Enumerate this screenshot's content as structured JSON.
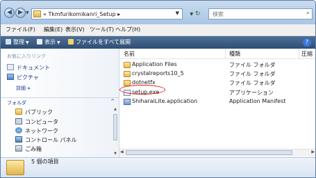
{
  "address": {
    "prefix": "«",
    "path": "Tkmfurikomikanri_Setup",
    "chevron": "▸"
  },
  "search": {
    "placeholder": "検索",
    "icon": "search-icon"
  },
  "nav": {
    "back_icon": "back-arrow-icon",
    "forward_icon": "forward-arrow-icon",
    "refresh_icon": "refresh-icon"
  },
  "menu": {
    "items": [
      "ファイル(F)",
      "編集(E)",
      "表示(V)",
      "ツール(T)",
      "ヘルプ(H)"
    ]
  },
  "toolbar": {
    "organize": "整理",
    "view": "表示",
    "burn": "ファイルをすべて展開"
  },
  "navpane": {
    "favorites_header": "お気に入りリンク",
    "favorites": [
      "ドキュメント",
      "ピクチャ"
    ],
    "more": "詳細",
    "more_icon": "»",
    "folders_header": "フォルダ",
    "collapse": "^",
    "tree": [
      "パブリック",
      "コンピュータ",
      "ネットワーク",
      "コントロール パネル",
      "ごみ箱"
    ]
  },
  "filelist": {
    "columns": [
      "名前",
      "種類",
      "圧縮"
    ],
    "rows": [
      {
        "name": "Application Files",
        "type": "ファイル フォルダ",
        "icon": "folder-icon"
      },
      {
        "name": "crystalreports10_5",
        "type": "ファイル フォルダ",
        "icon": "folder-icon"
      },
      {
        "name": "dotnetfx",
        "type": "ファイル フォルダ",
        "icon": "folder-icon"
      },
      {
        "name": "setup.exe",
        "type": "アプリケーション",
        "icon": "exe-icon"
      },
      {
        "name": "ShiharaiLite.application",
        "type": "Application Manifest",
        "icon": "application-manifest-icon"
      }
    ]
  },
  "details": {
    "count_text": "5 個の項目"
  },
  "colors": {
    "highlight": "#e02020",
    "commandbar": "#2f4e75",
    "link": "#1f3b8a"
  }
}
